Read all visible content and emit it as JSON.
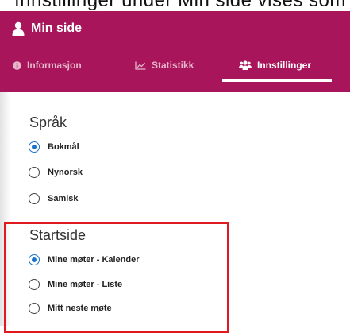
{
  "doc_fragment": "Innstillinger under Min side vises som i skjermbildet",
  "app": {
    "title": "Min side",
    "icon": "user-icon"
  },
  "tabs": [
    {
      "label": "Informasjon",
      "icon": "info-icon",
      "active": false
    },
    {
      "label": "Statistikk",
      "icon": "chart-icon",
      "active": false
    },
    {
      "label": "Innstillinger",
      "icon": "users-icon",
      "active": true
    }
  ],
  "language": {
    "title": "Språk",
    "options": [
      {
        "label": "Bokmål",
        "checked": true
      },
      {
        "label": "Nynorsk",
        "checked": false
      },
      {
        "label": "Samisk",
        "checked": false
      }
    ]
  },
  "startpage": {
    "title": "Startside",
    "options": [
      {
        "label": "Mine møter - Kalender",
        "checked": true
      },
      {
        "label": "Mine møter - Liste",
        "checked": false
      },
      {
        "label": "Mitt neste møte",
        "checked": false
      }
    ]
  },
  "colors": {
    "header": "#a8155a",
    "radio_checked": "#1a73c8",
    "highlight": "#e0191f"
  }
}
